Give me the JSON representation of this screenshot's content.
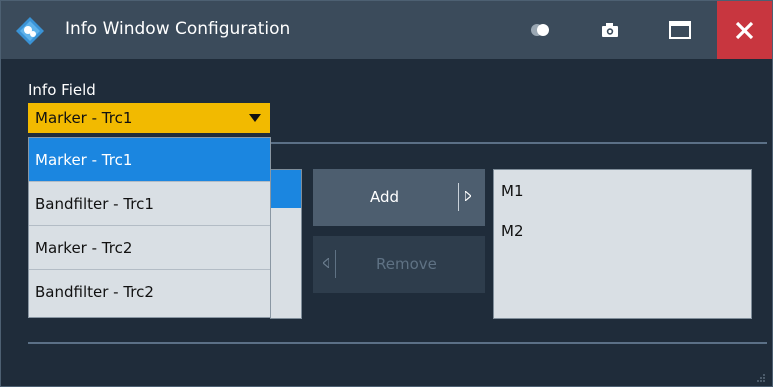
{
  "window": {
    "title": "Info Window Configuration",
    "colors": {
      "background": "#1f2c3a",
      "titlebar": "#3b4b5b",
      "close": "#c8363f",
      "combo": "#f2ba00",
      "selection": "#1b86e0"
    }
  },
  "titlebar": {
    "buttons": [
      "toggle-icon",
      "camera-icon",
      "maximize-icon",
      "close-icon"
    ]
  },
  "info_field": {
    "label": "Info Field",
    "selected": "Marker - Trc1",
    "options": [
      "Marker - Trc1",
      "Bandfilter - Trc1",
      "Marker - Trc2",
      "Bandfilter - Trc2"
    ]
  },
  "buttons": {
    "add_label": "Add",
    "remove_label": "Remove"
  },
  "selected_items": [
    "M1",
    "M2"
  ]
}
